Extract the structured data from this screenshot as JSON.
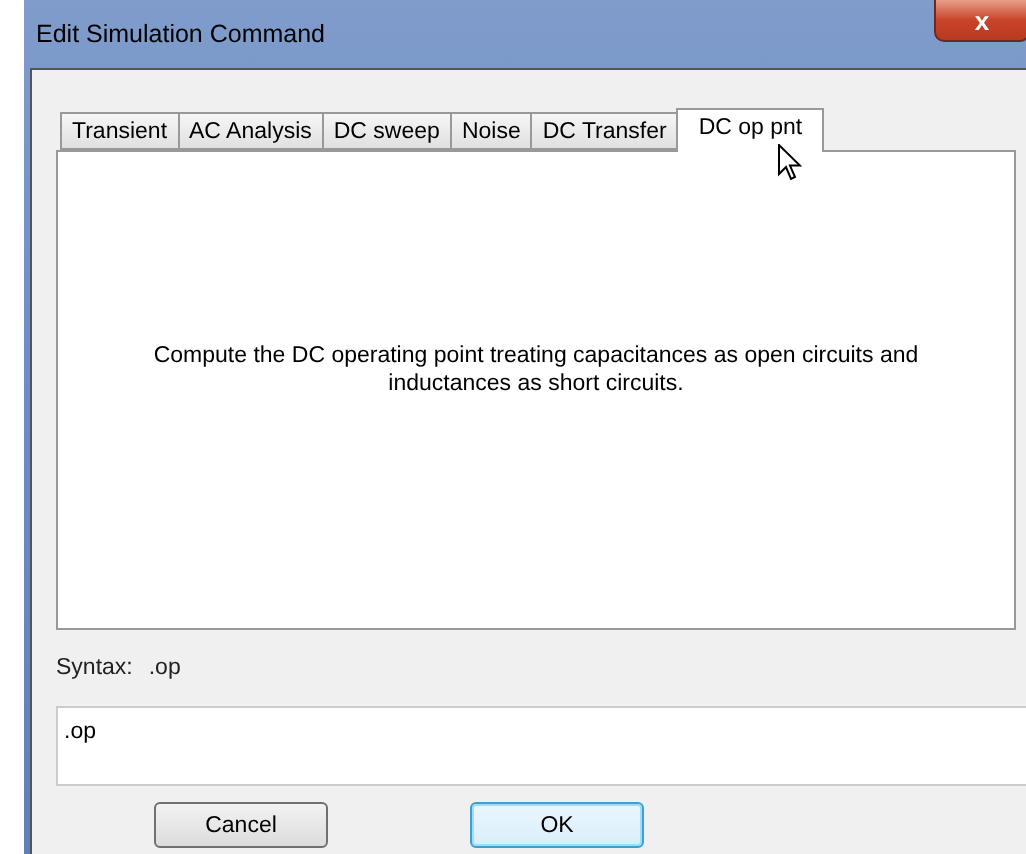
{
  "window": {
    "title": "Edit Simulation Command",
    "close": "x"
  },
  "tabs": [
    {
      "label": "Transient",
      "selected": false
    },
    {
      "label": "AC Analysis",
      "selected": false
    },
    {
      "label": "DC sweep",
      "selected": false
    },
    {
      "label": "Noise",
      "selected": false
    },
    {
      "label": "DC Transfer",
      "selected": false
    },
    {
      "label": "DC op pnt",
      "selected": true
    }
  ],
  "panel": {
    "description": "Compute the DC operating point treating capacitances as open circuits and inductances as short circuits."
  },
  "syntax": {
    "label": "Syntax:",
    "value": ".op"
  },
  "command_field": {
    "value": ".op"
  },
  "buttons": [
    {
      "label": "Cancel",
      "default": false
    },
    {
      "label": "OK",
      "default": true
    }
  ]
}
